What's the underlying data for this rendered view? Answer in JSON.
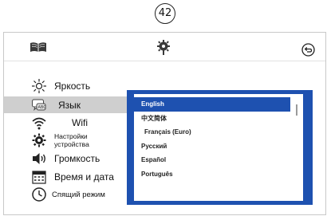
{
  "page_number": "42",
  "header": {
    "left_icon": "book-icon",
    "center_icon": "gear-settings-icon",
    "right_icon": "back-icon"
  },
  "menu": {
    "items": [
      {
        "label": "Яркость",
        "icon": "brightness-icon"
      },
      {
        "label": "Язык",
        "icon": "language-icon",
        "active": true
      },
      {
        "label": "Wifi",
        "icon": "wifi-icon"
      },
      {
        "label": "Настройки устройства",
        "line1": "Настройки",
        "line2": "устройства",
        "icon": "device-settings-icon"
      },
      {
        "label": "Громкость",
        "icon": "volume-icon"
      },
      {
        "label": "Время и дата",
        "icon": "calendar-icon"
      },
      {
        "label": "Спящий режим",
        "icon": "sleep-icon"
      }
    ]
  },
  "language_list": {
    "selected": "English",
    "options": [
      "English",
      "中文简体",
      "Français (Euro)",
      "Русский",
      "Español",
      "Português"
    ]
  },
  "colors": {
    "accent": "#1e51b0",
    "active_menu": "#cfcfcf"
  }
}
